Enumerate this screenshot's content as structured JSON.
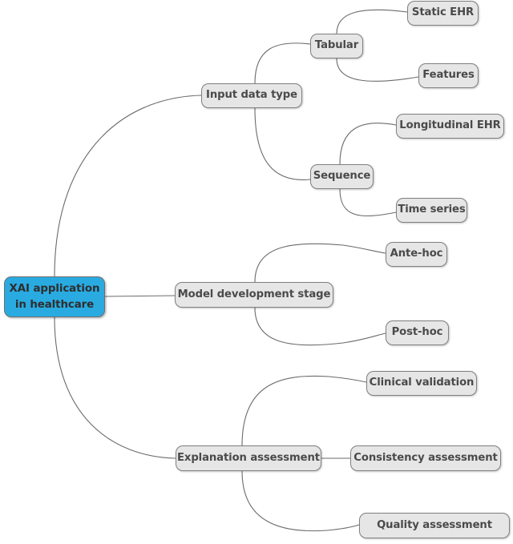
{
  "diagram": {
    "type": "mind-map",
    "title": "XAI application in healthcare",
    "root": {
      "id": "root",
      "label": "XAI application\nin healthcare",
      "label_line1": "XAI application",
      "label_line2": "in healthcare",
      "color": "#29ABE2",
      "text_color": "#2e2e2e",
      "border_color": "#6e6e6e"
    },
    "node_style": {
      "fill": "#e6e6e6",
      "border_color": "#808080",
      "text_color": "#4a4a4a",
      "edge_color": "#6b6b6b",
      "background": "#ffffff"
    },
    "branches": [
      {
        "id": "input-data-type",
        "label": "Input data type",
        "children": [
          {
            "id": "tabular",
            "label": "Tabular",
            "children": [
              {
                "id": "static-ehr",
                "label": "Static EHR"
              },
              {
                "id": "features",
                "label": "Features"
              }
            ]
          },
          {
            "id": "sequence",
            "label": "Sequence",
            "children": [
              {
                "id": "longitudinal-ehr",
                "label": "Longitudinal EHR"
              },
              {
                "id": "time-series",
                "label": "Time series"
              }
            ]
          }
        ]
      },
      {
        "id": "model-development-stage",
        "label": "Model development stage",
        "children": [
          {
            "id": "ante-hoc",
            "label": "Ante-hoc"
          },
          {
            "id": "post-hoc",
            "label": "Post-hoc"
          }
        ]
      },
      {
        "id": "explanation-assessment",
        "label": "Explanation assessment",
        "children": [
          {
            "id": "clinical-validation",
            "label": "Clinical validation"
          },
          {
            "id": "consistency-assessment",
            "label": "Consistency assessment"
          },
          {
            "id": "quality-assessment",
            "label": "Quality assessment"
          }
        ]
      }
    ]
  }
}
